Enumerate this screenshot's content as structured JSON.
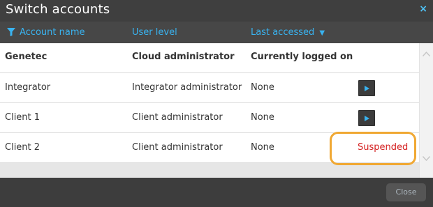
{
  "dialog": {
    "title": "Switch accounts",
    "close_icon": "×"
  },
  "columns": {
    "account_name": "Account name",
    "user_level": "User level",
    "last_accessed": "Last accessed",
    "sort_indicator": "▼"
  },
  "rows": [
    {
      "account": "Genetec",
      "level": "Cloud administrator",
      "last_accessed": "Currently logged on",
      "action": "none"
    },
    {
      "account": "Integrator",
      "level": "Integrator administrator",
      "last_accessed": "None",
      "action": "play"
    },
    {
      "account": "Client 1",
      "level": "Client administrator",
      "last_accessed": "None",
      "action": "play"
    },
    {
      "account": "Client 2",
      "level": "Client administrator",
      "last_accessed": "None",
      "status": "Suspended"
    }
  ],
  "footer": {
    "close_label": "Close"
  },
  "icons": {
    "filter": "filter-icon",
    "sort": "triangle-down-icon",
    "play": "play-icon",
    "close": "close-icon",
    "scroll_up": "chevron-up-icon",
    "scroll_down": "chevron-down-icon"
  },
  "colors": {
    "accent": "#39b3f0",
    "suspended": "#d41f1f",
    "highlight": "#f0a833",
    "title_bar": "#3f3f3f"
  }
}
